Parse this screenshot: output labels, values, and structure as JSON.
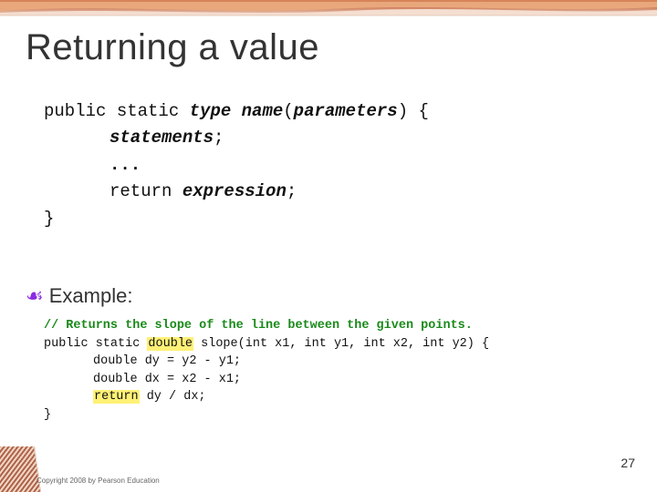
{
  "title": "Returning a value",
  "syntax": {
    "kw_public_static": "public static",
    "type": "type",
    "name": "name",
    "lparen": "(",
    "parameters": "parameters",
    "rparen_brace": ") {",
    "statements": "statements",
    "semi": ";",
    "ellipsis": "...",
    "kw_return": "return",
    "expression": "expression",
    "rbrace": "}"
  },
  "example_label": "Example:",
  "code": {
    "comment": "// Returns the slope of the line between the given points.",
    "sig_prefix": "public static ",
    "sig_double": "double",
    "sig_suffix": " slope(int x1, int y1, int x2, int y2) {",
    "l3": "double dy = y2 - y1;",
    "l4": "double dx = x2 - x1;",
    "l5_pre": "return",
    "l5_post": " dy / dx;",
    "l6": "}"
  },
  "footer": "Copyright 2008 by Pearson Education",
  "page": "27"
}
